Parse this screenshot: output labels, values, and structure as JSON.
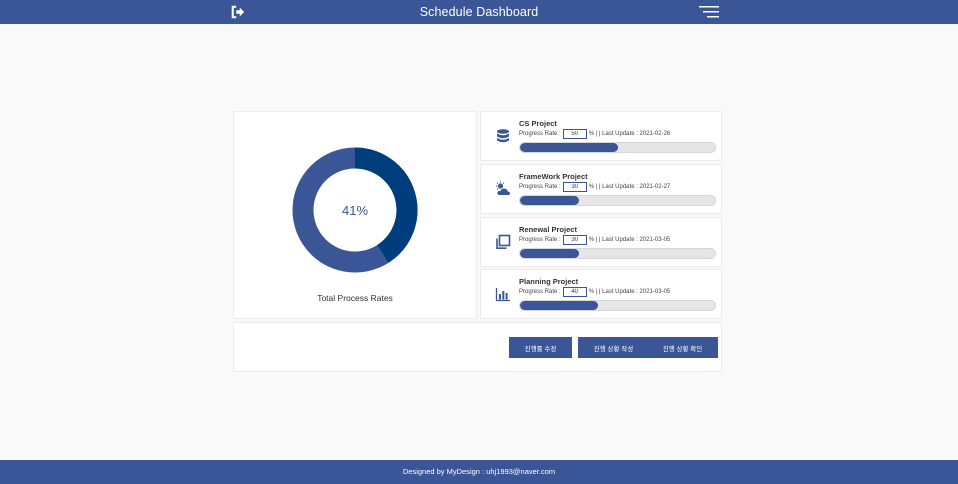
{
  "header": {
    "title": "Schedule Dashboard",
    "logout_icon": "sign-out-icon",
    "menu_icon": "hamburger-menu-icon"
  },
  "summary": {
    "percent_text": "41%",
    "percent": 41,
    "label": "Total Process Rates"
  },
  "projects": [
    {
      "name": "CS Project",
      "rate_label": "Progress Rate :",
      "rate": "50",
      "unit": "%",
      "sep": "| |",
      "update_label": "Last Update :",
      "date": "2021-02-26",
      "progress": 50,
      "icon": "database-icon"
    },
    {
      "name": "FrameWork Project",
      "rate_label": "Progress Rate :",
      "rate": "30",
      "unit": "%",
      "sep": "| |",
      "update_label": "Last Update :",
      "date": "2021-02-27",
      "progress": 30,
      "icon": "cloud-sun-icon"
    },
    {
      "name": "Renewal Project",
      "rate_label": "Progress Rate :",
      "rate": "30",
      "unit": "%",
      "sep": "| |",
      "update_label": "Last Update :",
      "date": "2021-03-05",
      "progress": 30,
      "icon": "copy-icon"
    },
    {
      "name": "Planning Project",
      "rate_label": "Progress Rate :",
      "rate": "40",
      "unit": "%",
      "sep": "| |",
      "update_label": "Last Update :",
      "date": "2021-03-05",
      "progress": 40,
      "icon": "bar-chart-icon"
    }
  ],
  "buttons": {
    "edit": "진행률 수정",
    "write": "진행 상황 작성",
    "check": "진행 상황 확인"
  },
  "footer": {
    "text": "Designed by MyDesign : uhj1993@naver.com"
  },
  "colors": {
    "brand": "#3a5697",
    "donut_done": "#003d7c",
    "donut_rest": "#3a5697"
  }
}
